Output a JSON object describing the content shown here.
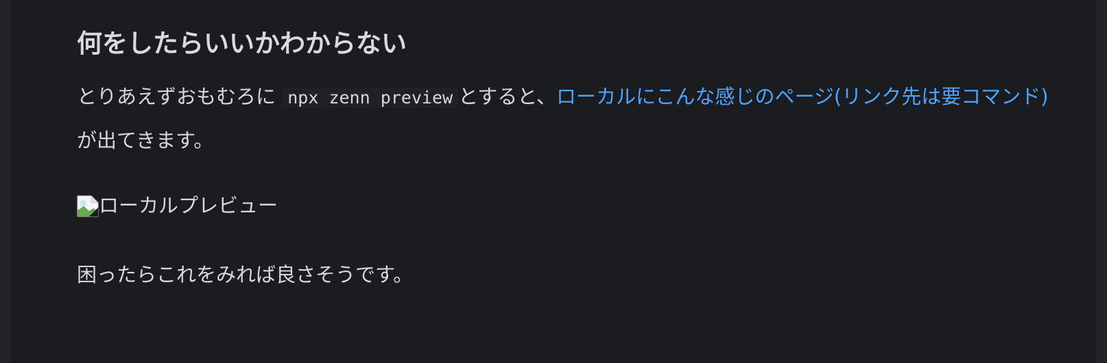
{
  "heading": "何をしたらいいかわからない",
  "paragraph1": {
    "before_code": "とりあえずおもむろに",
    "code": "npx zenn preview",
    "after_code": "とすると、",
    "link_text": "ローカルにこんな感じのページ(リンク先は要コマンド)",
    "after_link": "が出てきます。"
  },
  "image": {
    "alt": "ローカルプレビュー",
    "icon": "broken-image-icon"
  },
  "paragraph2": "困ったらこれをみれば良さそうです。",
  "colors": {
    "background": "#1b1c1f",
    "outer_background": "#232428",
    "text": "#d7d8da",
    "link": "#4da3ff",
    "code_background": "#202127"
  }
}
